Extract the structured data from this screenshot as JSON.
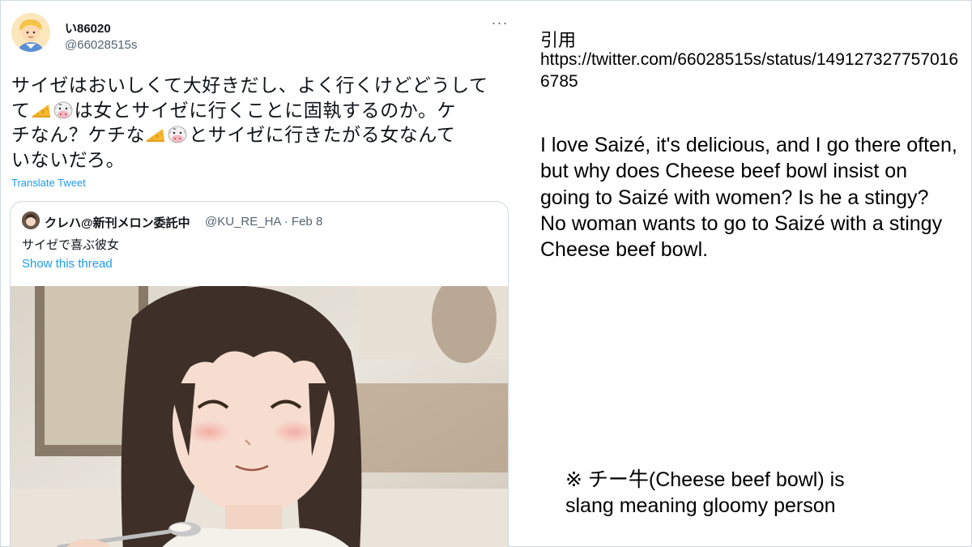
{
  "tweet": {
    "display_name": "い86020",
    "handle": "@66028515s",
    "more_label": "···",
    "text_line1": "サイゼはおいしくて大好きだし、よく行くけどどうして",
    "text_line2_after": "は女とサイゼに行くことに固執するのか。ケ",
    "text_line3_before": "チなん？ケチな",
    "text_line3_after": "とサイゼに行きたがる女なんて",
    "text_line4": "いないだろ。",
    "translate_label": "Translate Tweet",
    "emoji": [
      "cheese-icon",
      "cow-icon"
    ]
  },
  "quoted_tweet": {
    "display_name": "クレハ@新刊メロン委託中",
    "handle_date": "@KU_RE_HA · Feb 8",
    "text": "サイゼで喜ぶ彼女",
    "thread_label": "Show this thread",
    "media": "illustration of smiling girl holding a spoon"
  },
  "annotation": {
    "quote_label": "引用",
    "quote_url": "https://twitter.com/66028515s/status/1491273277570166785",
    "translation_line1": "I love Saizé, it's delicious, and I go there often, but why does Cheese beef bowl insist on going to Saizé with women? Is he a stingy?",
    "translation_line2": "No woman wants to go to Saizé with a stingy Cheese beef bowl.",
    "note_line1": "※ チー牛(Cheese beef bowl) is",
    "note_line2": "slang meaning gloomy person"
  },
  "colors": {
    "link": "#1d9bf0",
    "secondary_text": "#536471",
    "border": "#cfd9de"
  }
}
